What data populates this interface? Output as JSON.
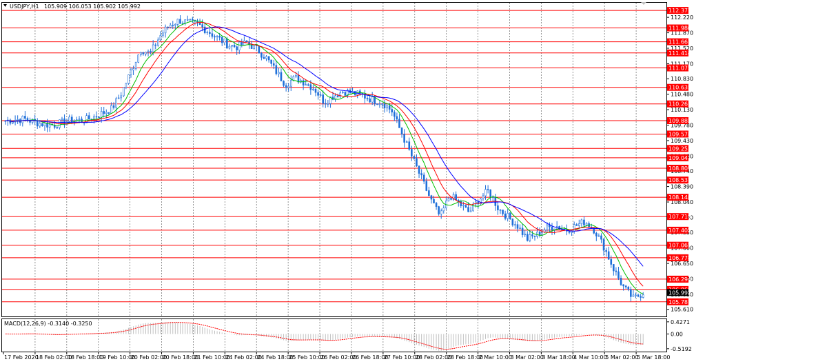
{
  "header": {
    "symbol": "USDJPY,H1",
    "ohlc": "105.909 106.053 105.902 105.992"
  },
  "macd_header": "MACD(12,26,9) -0.3140 -0.3250",
  "colors": {
    "level": "#ff0000",
    "ma_fast": "#00c000",
    "ma_mid": "#ff0000",
    "ma_slow": "#0000ff",
    "candle": "#1e6fd9",
    "grid": "#777777",
    "macd_hist": "#c0c0c0",
    "macd_signal": "#ff0000"
  },
  "chart_data": [
    {
      "type": "line",
      "title": "USDJPY,H1",
      "ylim": [
        105.45,
        112.55
      ],
      "price_ticks": [
        "112.220",
        "111.870",
        "111.520",
        "111.170",
        "110.830",
        "110.480",
        "110.130",
        "109.780",
        "109.430",
        "109.080",
        "108.740",
        "108.390",
        "108.040",
        "107.690",
        "107.350",
        "107.000",
        "106.650",
        "106.300",
        "105.950",
        "105.610"
      ],
      "time_labels": [
        "17 Feb 2020",
        "18 Feb 02:00",
        "18 Feb 18:00",
        "19 Feb 10:00",
        "20 Feb 02:00",
        "20 Feb 18:00",
        "21 Feb 10:00",
        "24 Feb 02:00",
        "24 Feb 18:00",
        "25 Feb 10:00",
        "26 Feb 02:00",
        "26 Feb 18:00",
        "27 Feb 10:00",
        "28 Feb 02:00",
        "28 Feb 18:00",
        "2 Mar 10:00",
        "3 Mar 02:00",
        "3 Mar 18:00",
        "4 Mar 10:00",
        "5 Mar 02:00",
        "5 Mar 18:00"
      ],
      "levels": [
        "112.377",
        "111.980",
        "111.667",
        "111.414",
        "111.075",
        "110.635",
        "110.261",
        "109.882",
        "109.578",
        "109.253",
        "109.041",
        "108.805",
        "108.537",
        "108.148",
        "107.710",
        "107.402",
        "107.062",
        "106.778",
        "106.294",
        "106.060",
        "105.781"
      ],
      "current_price": "105.992",
      "series": [
        {
          "values": [
            109.88,
            109.9,
            109.92,
            109.85,
            109.8,
            109.78,
            109.85,
            109.9,
            109.88,
            109.95,
            110.05,
            110.15,
            110.5,
            111.0,
            111.5,
            111.4,
            111.8,
            112.05,
            112.15,
            112.1,
            112.05,
            111.9,
            111.75,
            111.6,
            111.55,
            111.65,
            111.5,
            111.3,
            111.0,
            110.7,
            110.85,
            110.75,
            110.6,
            110.3,
            110.45,
            110.55,
            110.5,
            110.45,
            110.35,
            110.3,
            110.1,
            109.6,
            109.1,
            108.6,
            108.1,
            107.7,
            108.2,
            108.0,
            107.8,
            108.1,
            108.3,
            107.9,
            107.7,
            107.5,
            107.2,
            107.3,
            107.45,
            107.5,
            107.4,
            107.5,
            107.6,
            107.4,
            107.0,
            106.5,
            106.1,
            105.85,
            105.99
          ]
        }
      ]
    },
    {
      "type": "line",
      "title": "MACD(12,26,9) -0.3140 -0.3250",
      "ylim": [
        -0.62,
        0.52
      ],
      "ticks": [
        "0.4271",
        "0.00",
        "-0.5192"
      ]
    }
  ]
}
